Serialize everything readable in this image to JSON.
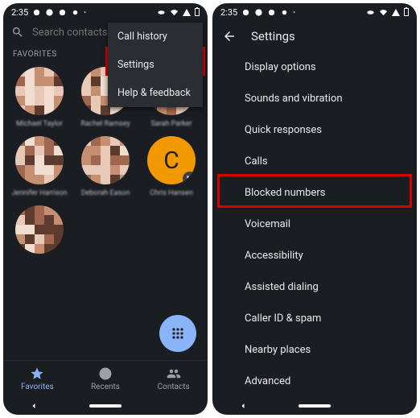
{
  "status": {
    "time": "2:35"
  },
  "left": {
    "search_placeholder": "Search contacts &",
    "dropdown": {
      "call_history": "Call history",
      "settings": "Settings",
      "help": "Help & feedback"
    },
    "favorites_label": "FAVORITES",
    "contacts": [
      {
        "name": "Michael Taylor"
      },
      {
        "name": "Rachel Ramsey"
      },
      {
        "name": "Sarah Parker"
      },
      {
        "name": "Jennifer Harrison"
      },
      {
        "name": "Deborah Eason"
      },
      {
        "name": "Chris Hansen",
        "initial": "C",
        "orange": true
      },
      {
        "name": ""
      }
    ],
    "tabs": {
      "favorites": "Favorites",
      "recents": "Recents",
      "contacts": "Contacts"
    }
  },
  "right": {
    "title": "Settings",
    "items": [
      "Display options",
      "Sounds and vibration",
      "Quick responses",
      "Calls",
      "Blocked numbers",
      "Voicemail",
      "Accessibility",
      "Assisted dialing",
      "Caller ID & spam",
      "Nearby places",
      "Advanced"
    ],
    "highlight_index": 4
  }
}
